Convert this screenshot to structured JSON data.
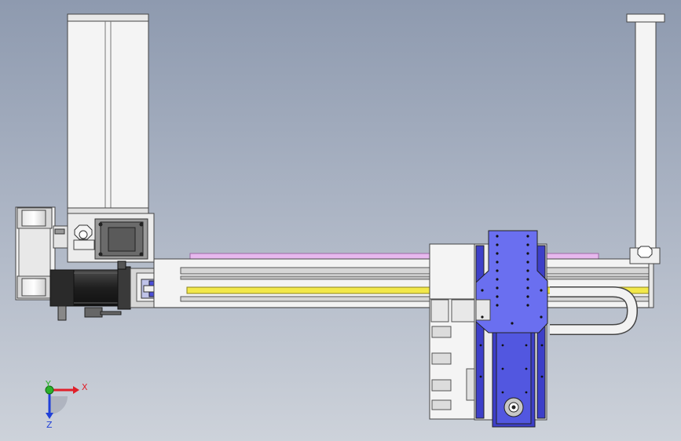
{
  "viewport": {
    "background_top": "#8e9aaf",
    "background_bottom": "#cdd2da"
  },
  "colors": {
    "part_white": "#f4f4f4",
    "part_light_gray": "#d4d4d4",
    "part_mid_gray": "#a8a8a8",
    "part_dark": "#3a3a3a",
    "motor_black": "#1e1e1e",
    "rail_yellow": "#f2e84a",
    "belt_pink": "#e7b8ee",
    "plate_blue": "#6a6ff0",
    "plate_blue_dark": "#3d3fc8",
    "axis_x": "#e0202a",
    "axis_y": "#2bb02b",
    "axis_z": "#2040d8"
  },
  "triad": {
    "x_label": "X",
    "y_label": "Y",
    "z_label": "Z"
  },
  "icons": {
    "triad": "coordinate-triad-icon"
  }
}
